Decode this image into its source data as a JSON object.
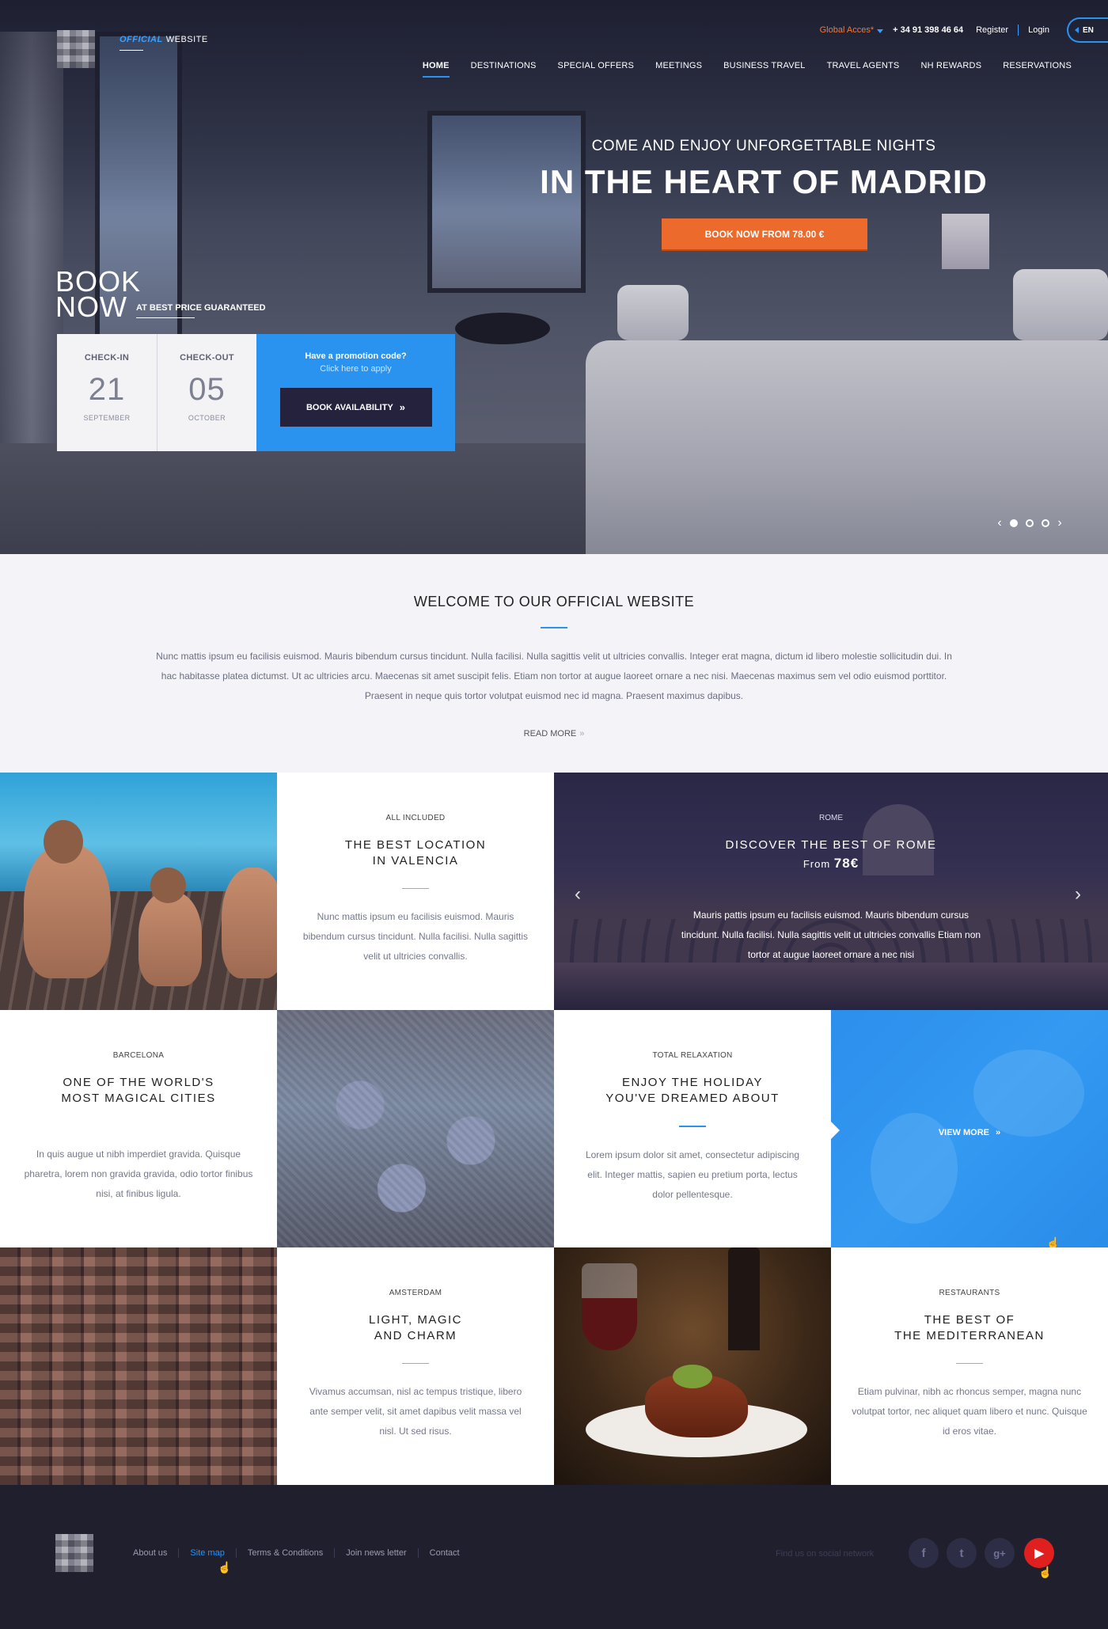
{
  "header": {
    "official": {
      "em": "OFFICIAL",
      "rest": "WEBSITE"
    },
    "global_acces": "Global Acces*",
    "phone": "+ 34 91 398 46 64",
    "register": "Register",
    "login": "Login",
    "lang": "EN",
    "nav": [
      "HOME",
      "DESTINATIONS",
      "SPECIAL OFFERS",
      "MEETINGS",
      "BUSINESS TRAVEL",
      "TRAVEL AGENTS",
      "NH REWARDS",
      "RESERVATIONS"
    ],
    "active_nav": "HOME"
  },
  "hero": {
    "subtitle": "COME AND ENJOY UNFORGETTABLE NIGHTS",
    "title": "IN THE HEART OF MADRID",
    "button": "BOOK NOW FROM 78.00 €",
    "slides_total": 3,
    "slide_active": 1
  },
  "booking": {
    "book_line1": "BOOK",
    "book_line2": "NOW",
    "guarantee": "AT BEST PRICE GUARANTEED",
    "checkin_label": "CHECK-IN",
    "checkin_day": "21",
    "checkin_month": "SEPTEMBER",
    "checkout_label": "CHECK-OUT",
    "checkout_day": "05",
    "checkout_month": "OCTOBER",
    "promo_q": "Have a promotion code?",
    "promo_link": "Click here to apply",
    "availability_btn": "BOOK AVAILABILITY"
  },
  "welcome": {
    "title": "WELCOME TO OUR OFFICIAL WEBSITE",
    "text": "Nunc mattis ipsum eu facilisis euismod. Mauris bibendum cursus tincidunt. Nulla facilisi. Nulla sagittis velit ut ultricies convallis. Integer erat magna, dictum id libero molestie sollicitudin dui. In hac habitasse platea dictumst. Ut ac ultricies arcu. Maecenas sit amet suscipit felis. Etiam non tortor at augue laoreet ornare a nec nisi. Maecenas maximus sem vel odio euismod porttitor. Praesent in neque quis tortor volutpat euismod nec id magna. Praesent maximus dapibus.",
    "read_more": "READ MORE"
  },
  "tiles": {
    "valencia": {
      "tag": "ALL INCLUDED",
      "title_1": "THE BEST LOCATION",
      "title_2": "IN VALENCIA",
      "desc": "Nunc mattis ipsum eu facilisis euismod. Mauris bibendum cursus tincidunt. Nulla facilisi. Nulla sagittis velit ut ultricies convallis."
    },
    "rome": {
      "tag": "ROME",
      "title": "DISCOVER THE BEST OF ROME",
      "from": "From",
      "price": "78€",
      "desc": "Mauris pattis ipsum eu facilisis euismod. Mauris bibendum cursus tincidunt. Nulla facilisi. Nulla sagittis velit ut ultricies convallis Etiam non tortor at augue laoreet ornare a nec nisi"
    },
    "barcelona": {
      "tag": "BARCELONA",
      "title_1": "ONE OF THE WORLD'S",
      "title_2": "MOST MAGICAL CITIES",
      "desc": "In quis augue ut nibh imperdiet gravida. Quisque pharetra, lorem non gravida gravida, odio tortor finibus nisi, at finibus ligula."
    },
    "relax": {
      "tag": "TOTAL RELAXATION",
      "title_1": "ENJOY THE HOLIDAY",
      "title_2": "YOU'VE DREAMED ABOUT",
      "desc": "Lorem ipsum dolor sit amet, consectetur adipiscing elit. Integer mattis, sapien eu pretium porta, lectus dolor pellentesque."
    },
    "spa": {
      "view_more": "VIEW MORE"
    },
    "amsterdam": {
      "tag": "AMSTERDAM",
      "title_1": "LIGHT, MAGIC",
      "title_2": "AND CHARM",
      "desc": "Vivamus accumsan, nisl ac tempus tristique, libero ante semper velit, sit amet dapibus velit massa vel nisl. Ut sed risus."
    },
    "restaurants": {
      "tag": "RESTAURANTS",
      "title_1": "THE BEST OF",
      "title_2": "THE MEDITERRANEAN",
      "desc": "Etiam pulvinar, nibh ac rhoncus semper, magna nunc volutpat tortor, nec aliquet quam libero et nunc. Quisque id eros vitae."
    }
  },
  "footer": {
    "links": [
      "About us",
      "Site map",
      "Terms & Conditions",
      "Join news letter",
      "Contact"
    ],
    "active_link": "Site map",
    "find_us": "Find us on social network",
    "social": [
      "facebook-icon",
      "twitter-icon",
      "googleplus-icon",
      "youtube-icon"
    ]
  },
  "colors": {
    "accent": "#2a93f0",
    "orange": "#ec6a2c",
    "navy": "#25223d",
    "footer": "#1f1f2e",
    "youtube": "#e0201e"
  }
}
